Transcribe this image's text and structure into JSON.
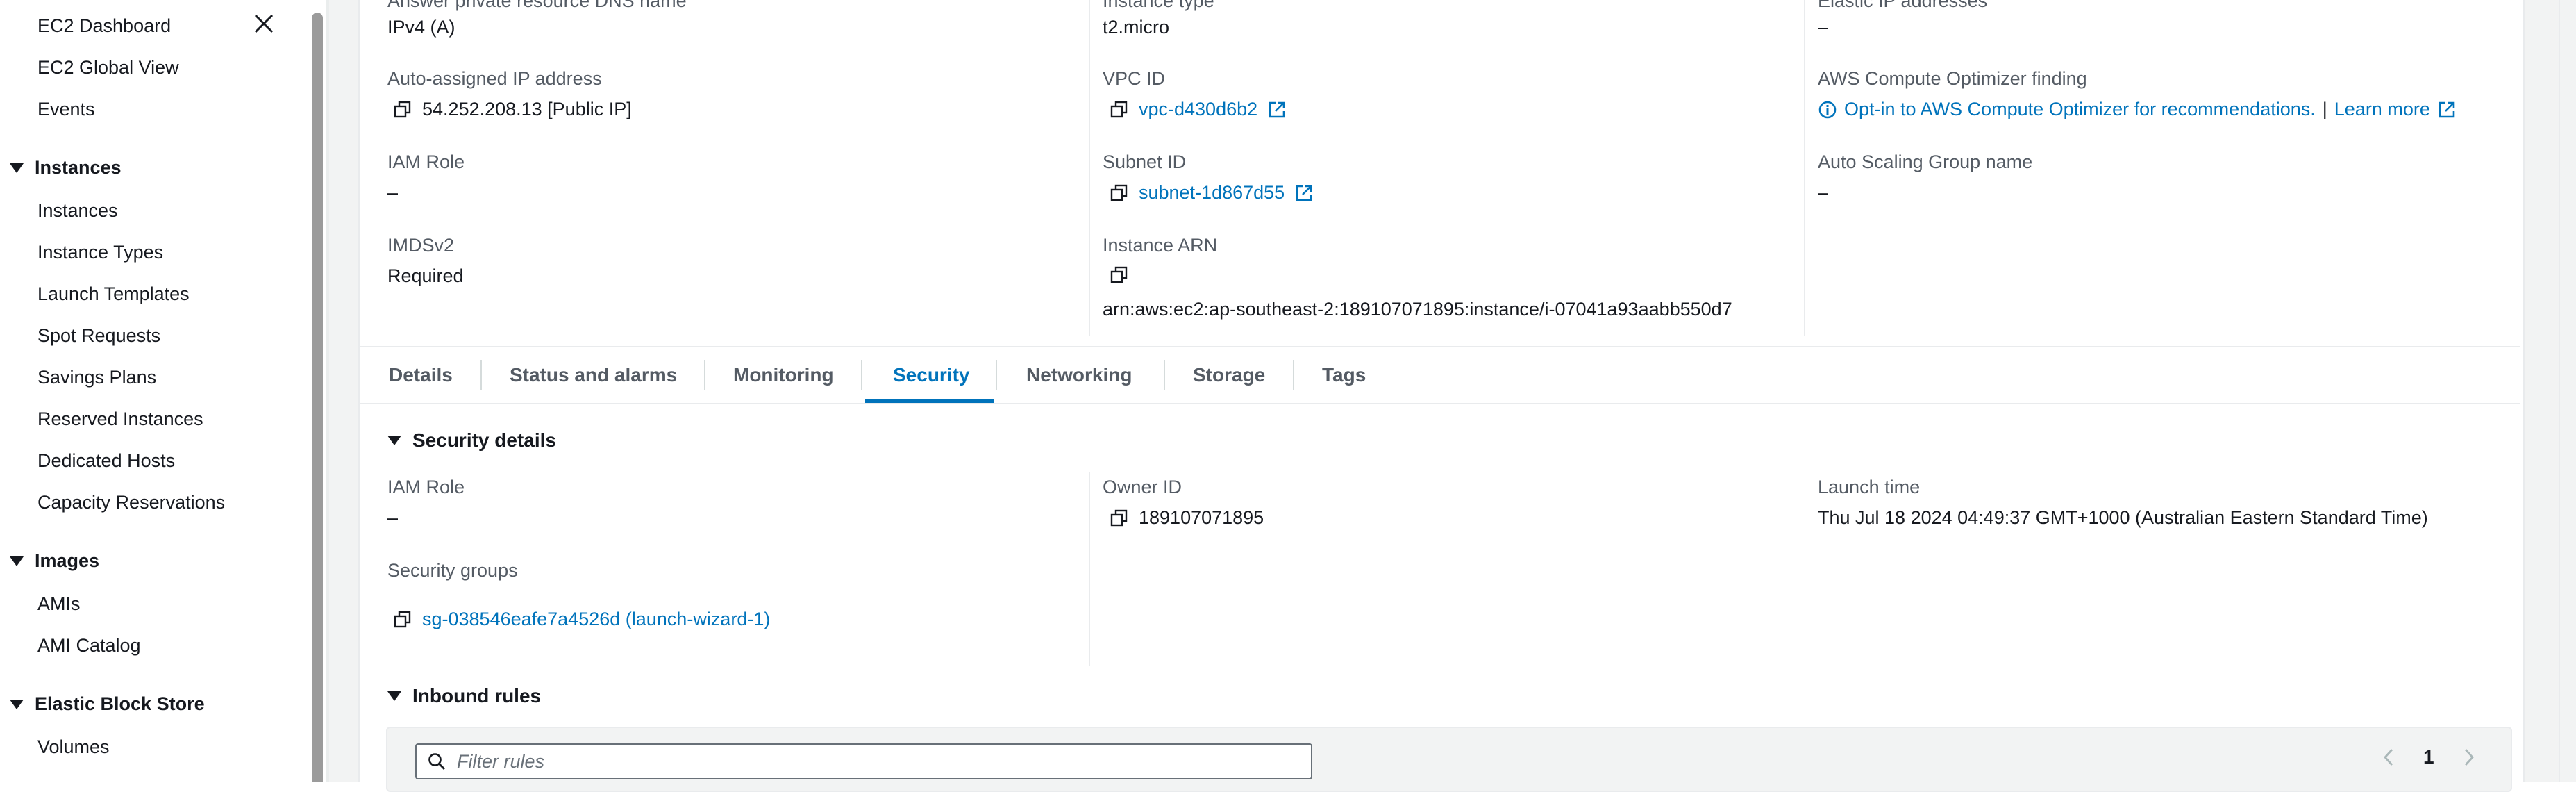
{
  "sidebar": {
    "top_items": [
      "EC2 Dashboard",
      "EC2 Global View",
      "Events"
    ],
    "groups": [
      {
        "title": "Instances",
        "items": [
          "Instances",
          "Instance Types",
          "Launch Templates",
          "Spot Requests",
          "Savings Plans",
          "Reserved Instances",
          "Dedicated Hosts",
          "Capacity Reservations"
        ]
      },
      {
        "title": "Images",
        "items": [
          "AMIs",
          "AMI Catalog"
        ]
      },
      {
        "title": "Elastic Block Store",
        "items": [
          "Volumes"
        ]
      }
    ]
  },
  "summary": {
    "col1": {
      "cut_label": "Answer private resource DNS name",
      "cut_value": "IPv4 (A)",
      "auto_ip_label": "Auto-assigned IP address",
      "auto_ip_value": "54.252.208.13 [Public IP]",
      "iam_label": "IAM Role",
      "iam_value": "–",
      "imds_label": "IMDSv2",
      "imds_value": "Required"
    },
    "col2": {
      "cut_label": "Instance type",
      "cut_value": "t2.micro",
      "vpc_label": "VPC ID",
      "vpc_value": "vpc-d430d6b2",
      "subnet_label": "Subnet ID",
      "subnet_value": "subnet-1d867d55",
      "arn_label": "Instance ARN",
      "arn_value": "arn:aws:ec2:ap-southeast-2:189107071895:instance/i-07041a93aabb550d7"
    },
    "col3": {
      "cut_label": "Elastic IP addresses",
      "cut_value": "–",
      "optimizer_label": "AWS Compute Optimizer finding",
      "optimizer_link": "Opt-in to AWS Compute Optimizer for recommendations.",
      "optimizer_sep": "|",
      "learn_more": "Learn more",
      "asg_label": "Auto Scaling Group name",
      "asg_value": "–"
    }
  },
  "tabs": [
    "Details",
    "Status and alarms",
    "Monitoring",
    "Security",
    "Networking",
    "Storage",
    "Tags"
  ],
  "active_tab": "Security",
  "security_details": {
    "heading": "Security details",
    "iam_label": "IAM Role",
    "iam_value": "–",
    "sg_label": "Security groups",
    "sg_value": "sg-038546eafe7a4526d (launch-wizard-1)",
    "owner_label": "Owner ID",
    "owner_value": "189107071895",
    "launch_label": "Launch time",
    "launch_value": "Thu Jul 18 2024 04:49:37 GMT+1000 (Australian Eastern Standard Time)"
  },
  "inbound": {
    "heading": "Inbound rules",
    "filter_placeholder": "Filter rules",
    "page": "1"
  },
  "colors": {
    "link": "#0073bb",
    "text": "#16191f",
    "muted": "#545b64"
  }
}
